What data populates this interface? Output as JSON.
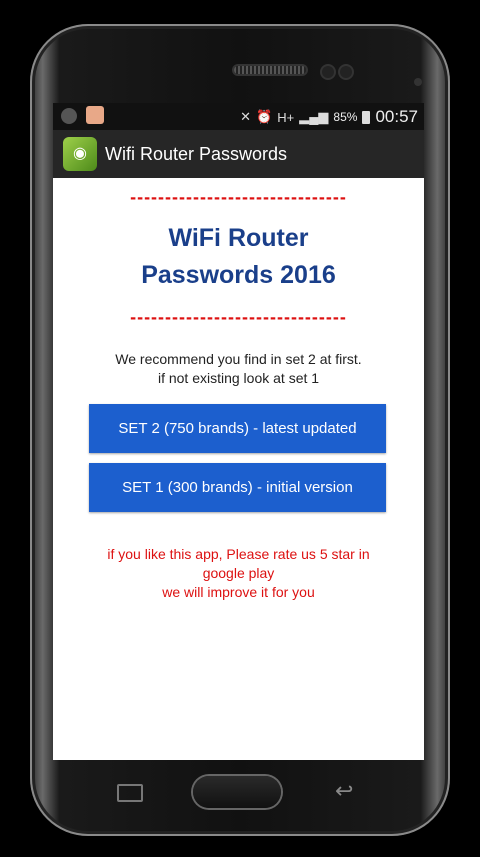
{
  "statusbar": {
    "battery": "85%",
    "time": "00:57",
    "network": "H+"
  },
  "appbar": {
    "title": "Wifi Router Passwords",
    "logo_icon": "wifi-app-logo-icon"
  },
  "main": {
    "divider": "-------------------------------",
    "headline_line1": "WiFi Router",
    "headline_line2": "Passwords 2016",
    "recommend_line1": "We recommend you find in set 2 at first.",
    "recommend_line2": "if not existing look at set 1",
    "button_set2": "SET 2 (750 brands) - latest updated",
    "button_set1": "SET 1 (300 brands) - initial version",
    "rate_line1": "if you like this app, Please rate us 5 star in google play",
    "rate_line2": "we will improve it for you"
  },
  "colors": {
    "accent_button": "#1c5fce",
    "headline": "#1a3f8a",
    "warning_text": "#d11111",
    "appbar": "#262626"
  }
}
